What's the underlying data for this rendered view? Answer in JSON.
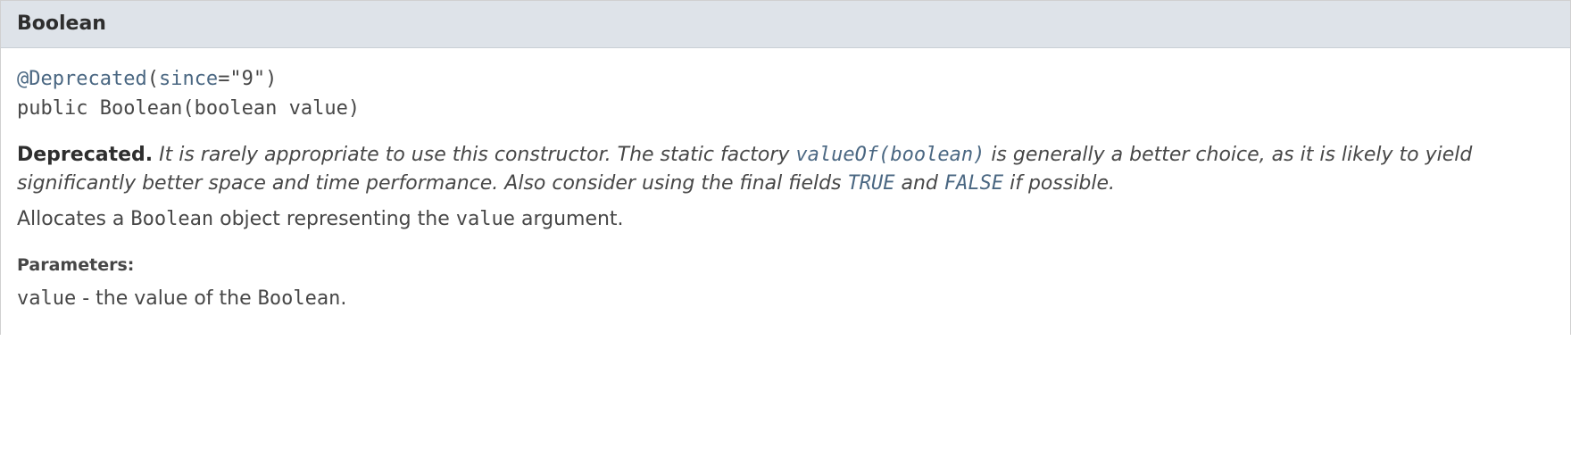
{
  "header": {
    "title": "Boolean"
  },
  "signature": {
    "annotation_link": "@Deprecated",
    "annotation_tail_pre": "(",
    "since_link": "since",
    "annotation_tail_post": "=\"9\")",
    "line2": "public Boolean(boolean value)"
  },
  "deprecation": {
    "label": "Deprecated.",
    "text_before_valueOf": " It is rarely appropriate to use this constructor. The static factory ",
    "valueOf_link": "valueOf(boolean)",
    "text_between_valueOf_and_TRUE": " is generally a better choice, as it is likely to yield significantly better space and time performance. Also consider using the final fields ",
    "true_link": "TRUE",
    "text_and": " and ",
    "false_link": "FALSE",
    "text_after_FALSE": " if possible."
  },
  "description": {
    "before_code1": "Allocates a ",
    "code1": "Boolean",
    "mid": " object representing the ",
    "code2": "value",
    "after": " argument."
  },
  "parameters": {
    "heading": "Parameters:",
    "items": [
      {
        "name": "value",
        "sep": " - the value of the ",
        "code": "Boolean",
        "tail": "."
      }
    ]
  }
}
